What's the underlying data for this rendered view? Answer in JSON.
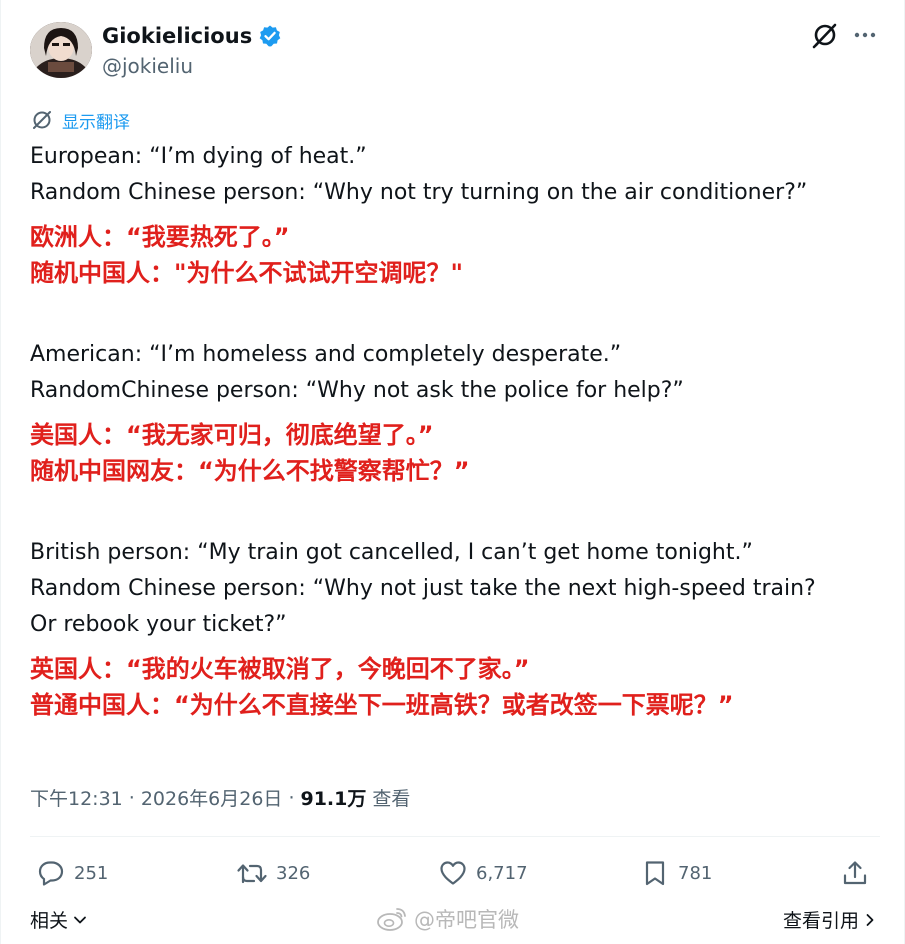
{
  "header": {
    "display_name": "Giokielicious",
    "handle": "@jokieliu"
  },
  "translate": {
    "label": "显示翻译"
  },
  "post": {
    "blocks": [
      {
        "en": [
          "European: “I’m dying of heat.”",
          "Random Chinese person: “Why not try turning on the air conditioner?”"
        ],
        "zh": [
          "欧洲人：“我要热死了。”",
          "随机中国人：\"为什么不试试开空调呢？\""
        ]
      },
      {
        "en": [
          "American: “I’m homeless and completely desperate.”",
          "RandomChinese person: “Why not ask the police for help?”"
        ],
        "zh": [
          "美国人：“我无家可归，彻底绝望了。”",
          "随机中国网友：“为什么不找警察帮忙？”"
        ]
      },
      {
        "en": [
          "British person: “My train got cancelled, I can’t get home tonight.”",
          "Random Chinese person: “Why not just take the next high-speed train?",
          "Or rebook your ticket?”"
        ],
        "zh": [
          "英国人：“我的火车被取消了，今晚回不了家。”",
          "普通中国人：“为什么不直接坐下一班高铁？或者改签一下票呢？”"
        ]
      }
    ]
  },
  "meta": {
    "time": "下午12:31",
    "date": "2026年6月26日",
    "views": "91.1万",
    "views_label": "查看"
  },
  "actions": {
    "replies": "251",
    "reposts": "326",
    "likes": "6,717",
    "bookmarks": "781"
  },
  "footer": {
    "related": "相关",
    "view_quotes": "查看引用",
    "watermark": "@帝吧官微"
  },
  "colors": {
    "accent": "#1d9bf0",
    "verified": "#1d9bf0",
    "chinese_text": "#e0201c",
    "secondary_text": "#536471"
  }
}
